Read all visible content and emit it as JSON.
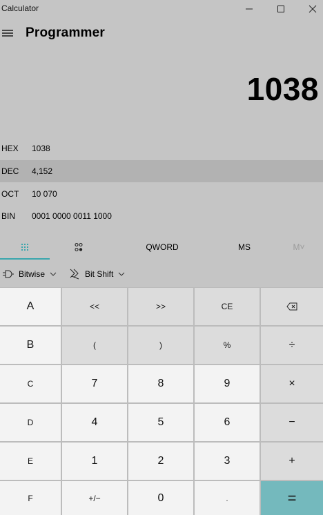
{
  "window": {
    "title": "Calculator"
  },
  "header": {
    "mode": "Programmer"
  },
  "display": {
    "value": "1038"
  },
  "radix": [
    {
      "label": "HEX",
      "value": "1038",
      "selected": false
    },
    {
      "label": "DEC",
      "value": "4,152",
      "selected": true
    },
    {
      "label": "OCT",
      "value": "10 070",
      "selected": false
    },
    {
      "label": "BIN",
      "value": "0001 0000 0011 1000",
      "selected": false
    }
  ],
  "tabs": {
    "word_size": "QWORD",
    "ms": "MS",
    "mplus": "M˅"
  },
  "operators": {
    "bitwise": "Bitwise",
    "bitshift": "Bit Shift"
  },
  "keys": {
    "a": "A",
    "lshift": "<<",
    "rshift": ">>",
    "ce": "CE",
    "b": "B",
    "lparen": "(",
    "rparen": ")",
    "mod": "%",
    "divide": "÷",
    "c": "C",
    "seven": "7",
    "eight": "8",
    "nine": "9",
    "multiply": "×",
    "d": "D",
    "four": "4",
    "five": "5",
    "six": "6",
    "minus": "−",
    "e": "E",
    "one": "1",
    "two": "2",
    "three": "3",
    "plus": "+",
    "f": "F",
    "negate": "+/−",
    "zero": "0",
    "decimal": ".",
    "equals": "="
  },
  "colors": {
    "accent": "#3aa6ad",
    "equals_key": "#74b9bd"
  }
}
